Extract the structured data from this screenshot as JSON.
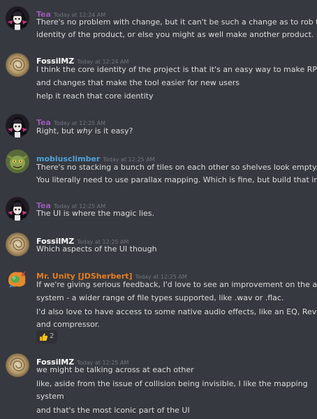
{
  "colors": {
    "background": "#36393f",
    "tea": "#9b59b6",
    "fossil": "#ffffff",
    "mobius": "#4fa3d9",
    "unity": "#e67e22",
    "text": "#dcddde",
    "timestamp": "#72767d"
  },
  "messages": [
    {
      "author": "Tea",
      "time": "Today at 12:24 AM",
      "lines": [
        "There's no problem with change, but it can't be such a change as to rob the",
        "identity of the product, or else you might as well make another product."
      ]
    },
    {
      "author": "FossilMZ",
      "time": "Today at 12:24 AM",
      "lines": [
        "I think the core identity of the project is that it's an easy way to make RPGs",
        "and changes that make the tool easier for new users",
        "help it reach that core identity"
      ]
    },
    {
      "author": "Tea",
      "time": "Today at 12:25 AM",
      "lines": [
        "Right, but ",
        "why",
        " is it easy?"
      ]
    },
    {
      "author": "mobiusclimber",
      "time": "Today at 12:25 AM",
      "lines": [
        "There's no stacking a bunch of tiles on each other so shelves look empty.",
        "You literally need to use parallax mapping. Which is fine, but build that in"
      ]
    },
    {
      "author": "Tea",
      "time": "Today at 12:25 AM",
      "lines": [
        "The UI is where the magic lies."
      ]
    },
    {
      "author": "FossilMZ",
      "time": "Today at 12:25 AM",
      "lines": [
        "Which aspects of the UI though"
      ]
    },
    {
      "author": "Mr. Unity [JDSherbert]",
      "time": "Today at 12:25 AM",
      "lines": [
        "If we're giving serious feedback, I'd love to see an improvement on the audio",
        "system - a wider range of file types supported, like .wav or .flac.",
        "I'd also love to have access to some native audio effects, like an EQ, Reverb,",
        "and compressor."
      ],
      "reaction": {
        "emoji": "thumbs-up-icon",
        "count": "2"
      }
    },
    {
      "author": "FossilMZ",
      "time": "Today at 12:25 AM",
      "lines": [
        "we might be talking across at each other",
        "like, aside from the issue of collision being invisible, I like the mapping",
        "system",
        "and that's the most iconic part of the UI"
      ]
    }
  ]
}
